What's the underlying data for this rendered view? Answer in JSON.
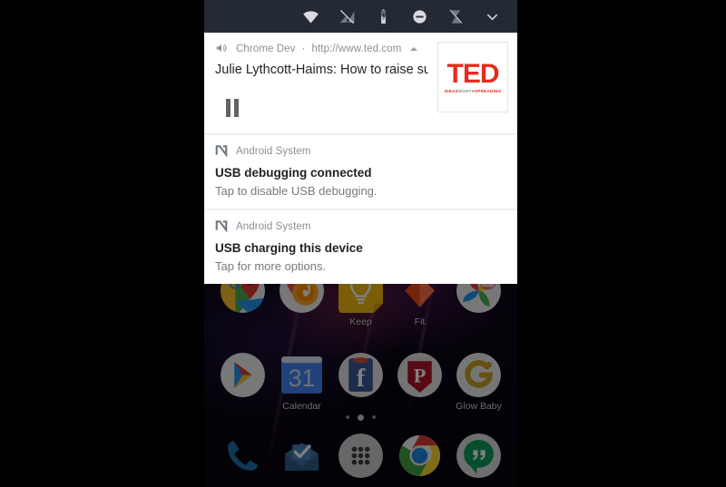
{
  "device": {
    "screen_bg": "#0a0614",
    "letterbox_color": "#000000"
  },
  "statusbar": {
    "background": "#232a33",
    "icons": [
      {
        "name": "wifi-icon",
        "label": "Wi-Fi connected"
      },
      {
        "name": "cell-signal-off-icon",
        "label": "No cellular signal"
      },
      {
        "name": "battery-charging-icon",
        "label": "Battery charging"
      },
      {
        "name": "do-not-disturb-icon",
        "label": "Do not disturb"
      },
      {
        "name": "alarm-off-icon",
        "label": "Alarm off"
      },
      {
        "name": "chevron-down-icon",
        "label": "Collapse quick settings"
      }
    ]
  },
  "shade": {
    "background": "#eceff1",
    "notifications": [
      {
        "id": "media",
        "type": "media",
        "app_icon": "speaker-icon",
        "app_name": "Chrome Dev",
        "separator": "·",
        "source": "http://www.ted.com",
        "expand_icon": "chevron-up-icon",
        "title": "Julie Lythcott-Haims: How to raise succes..",
        "action_icon": "pause-icon",
        "album_art": {
          "name": "ted-logo",
          "wordmark": "TED",
          "tagline_parts": [
            "IDEAS",
            "WORTH",
            "SPREADING"
          ],
          "color": "#e62b1e"
        }
      },
      {
        "id": "usb-debugging",
        "type": "text",
        "app_icon": "android-system-icon",
        "app_name": "Android System",
        "title": "USB debugging connected",
        "text": "Tap to disable USB debugging."
      },
      {
        "id": "usb-charging",
        "type": "text",
        "app_icon": "android-system-icon",
        "app_name": "Android System",
        "title": "USB charging this device",
        "text": "Tap for more options."
      }
    ]
  },
  "homescreen": {
    "rows": [
      {
        "apps": [
          {
            "name": "maps",
            "label": "",
            "icon": "maps-icon"
          },
          {
            "name": "play-music",
            "label": "",
            "icon": "play-music-icon"
          },
          {
            "name": "keep",
            "label": "Keep",
            "icon": "keep-icon"
          },
          {
            "name": "fit",
            "label": "Fit",
            "icon": "fit-icon"
          },
          {
            "name": "photos",
            "label": "",
            "icon": "photos-icon"
          }
        ]
      },
      {
        "apps": [
          {
            "name": "play-store",
            "label": "",
            "icon": "play-store-icon"
          },
          {
            "name": "calendar",
            "label": "Calendar",
            "icon": "calendar-icon",
            "day": "31"
          },
          {
            "name": "facebook",
            "label": "",
            "icon": "facebook-icon",
            "glyph": "f"
          },
          {
            "name": "pandora",
            "label": "",
            "icon": "pandora-icon",
            "glyph": "P"
          },
          {
            "name": "glow-baby",
            "label": "Glow Baby",
            "icon": "glow-baby-icon"
          }
        ]
      }
    ],
    "page_indicator": {
      "count": 3,
      "active_index": 1
    },
    "dock": [
      {
        "name": "phone",
        "icon": "phone-icon"
      },
      {
        "name": "inbox",
        "icon": "inbox-icon"
      },
      {
        "name": "app-drawer",
        "icon": "apps-grid-icon"
      },
      {
        "name": "chrome",
        "icon": "chrome-icon"
      },
      {
        "name": "hangouts",
        "icon": "hangouts-icon"
      }
    ]
  }
}
